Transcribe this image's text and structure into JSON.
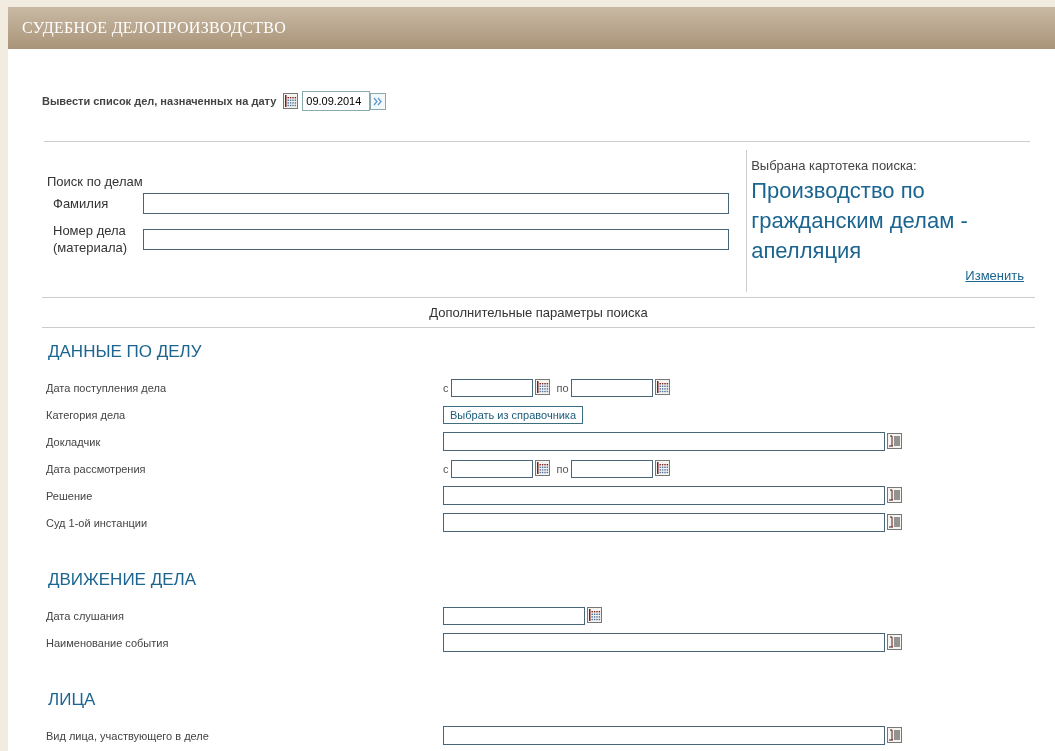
{
  "header": {
    "title": "СУДЕБНОЕ ДЕЛОПРОИЗВОДСТВО"
  },
  "date_filter": {
    "label": "Вывести список дел, назначенных на дату",
    "value": "09.09.2014"
  },
  "search": {
    "title": "Поиск по делам",
    "fields": [
      {
        "label": "Фамилия"
      },
      {
        "label": "Номер дела (материала)"
      }
    ]
  },
  "selected_index": {
    "caption": "Выбрана картотека поиска:",
    "name": "Производство по гражданским делам - апелляция",
    "change_link": "Изменить"
  },
  "advanced_title": "Дополнительные параметры поиска",
  "sections": [
    {
      "title": "ДАННЫЕ ПО ДЕЛУ",
      "rows": [
        {
          "label": "Дата поступления дела",
          "kind": "range",
          "from": "с",
          "to": "по"
        },
        {
          "label": "Категория дела",
          "kind": "button",
          "button": "Выбрать из справочника"
        },
        {
          "label": "Докладчик",
          "kind": "list"
        },
        {
          "label": "Дата рассмотрения",
          "kind": "range",
          "from": "с",
          "to": "по"
        },
        {
          "label": "Решение",
          "kind": "list"
        },
        {
          "label": "Суд 1-ой инстанции",
          "kind": "list"
        }
      ]
    },
    {
      "title": "ДВИЖЕНИЕ ДЕЛА",
      "rows": [
        {
          "label": "Дата слушания",
          "kind": "date"
        },
        {
          "label": "Наименование события",
          "kind": "list"
        }
      ]
    },
    {
      "title": "ЛИЦА",
      "rows": [
        {
          "label": "Вид лица, участвующего в деле",
          "kind": "list"
        }
      ]
    }
  ]
}
